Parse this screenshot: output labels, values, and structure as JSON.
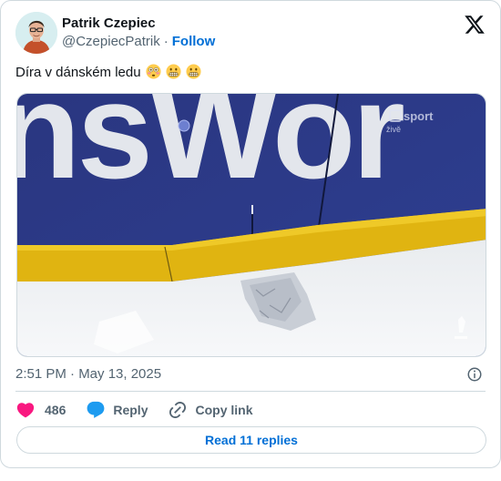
{
  "tweet": {
    "author": {
      "display_name": "Patrik Czepiec",
      "handle": "@CzepiecPatrik",
      "separator": "·",
      "follow_label": "Follow"
    },
    "text": "Díra v dánském ledu",
    "emojis": [
      "flushed-face-emoji",
      "grimacing-face-emoji",
      "grimacing-face-emoji"
    ],
    "media": {
      "board_text": "nsWor",
      "watermark_text": "sport",
      "watermark_sub": "živě"
    },
    "timestamp": "2:51 PM · May 13, 2025",
    "likes": "486",
    "reply_label": "Reply",
    "copy_link_label": "Copy link",
    "read_replies_label": "Read 11 replies"
  },
  "colors": {
    "accent": "#006fd6",
    "like": "#f91880",
    "reply": "#1d9bf0",
    "muted": "#536471",
    "board_blue": "#2c3b8c",
    "board_yellow": "#e2b60f"
  }
}
